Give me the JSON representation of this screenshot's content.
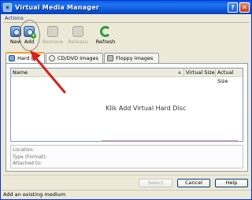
{
  "window": {
    "title": "Virtual Media Manager",
    "help_glyph": "?",
    "close_glyph": "✕"
  },
  "actions": {
    "label": "Actions",
    "buttons": [
      {
        "label": "New",
        "icon": "hard-disk-icon",
        "enabled": true
      },
      {
        "label": "Add",
        "icon": "add-disk-icon",
        "enabled": true
      },
      {
        "label": "Remove",
        "icon": "remove-icon",
        "enabled": false
      },
      {
        "label": "Release",
        "icon": "release-icon",
        "enabled": false
      },
      {
        "label": "Refresh",
        "icon": "refresh-icon",
        "enabled": true
      }
    ]
  },
  "tabs": [
    {
      "label": "Hard Di",
      "icon": "hard-disk-icon",
      "active": true
    },
    {
      "label": "CD/DVD Images",
      "icon": "cd-icon",
      "active": false
    },
    {
      "label": "Floppy Images",
      "icon": "floppy-icon",
      "active": false
    }
  ],
  "list": {
    "columns": [
      "Name",
      "Virtual Size",
      "Actual Size"
    ],
    "sort_glyph": "▲",
    "overlay_note": "Klik Add Virtual Hard Disc"
  },
  "details": {
    "location_label": "Location:",
    "type_label": "Type (Format):",
    "attached_label": "Attached to:"
  },
  "dialog_buttons": {
    "select": "Select",
    "cancel": "Cancel",
    "help": "Help"
  },
  "status": {
    "text": "Add an existing medium"
  },
  "colors": {
    "title_bar": "#0a5fe0",
    "annotation_red": "#d8201c"
  }
}
